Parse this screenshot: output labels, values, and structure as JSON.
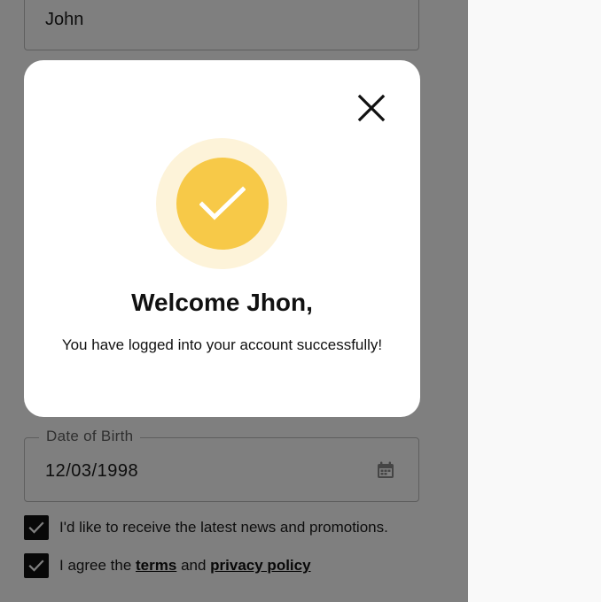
{
  "form": {
    "name_value": "John",
    "dob": {
      "label": "Date of Birth",
      "value": "12/03/1998",
      "icon": "calendar-icon"
    },
    "news_checkbox": {
      "checked": true,
      "label": "I'd like to receive the latest news and promotions."
    },
    "terms_checkbox": {
      "checked": true,
      "prefix": "I agree the",
      "terms_link": "terms",
      "conjunction": "and",
      "privacy_link": "privacy policy"
    }
  },
  "dialog": {
    "title": "Welcome Jhon,",
    "message": "You have logged into your account successfully!",
    "close_icon": "close-icon",
    "success_icon": "checkmark-icon"
  },
  "colors": {
    "accent": "#f7c948",
    "accent_halo": "#fdf3d9",
    "scrim": "rgba(0,0,0,0.5)",
    "checkbox": "#111111"
  }
}
